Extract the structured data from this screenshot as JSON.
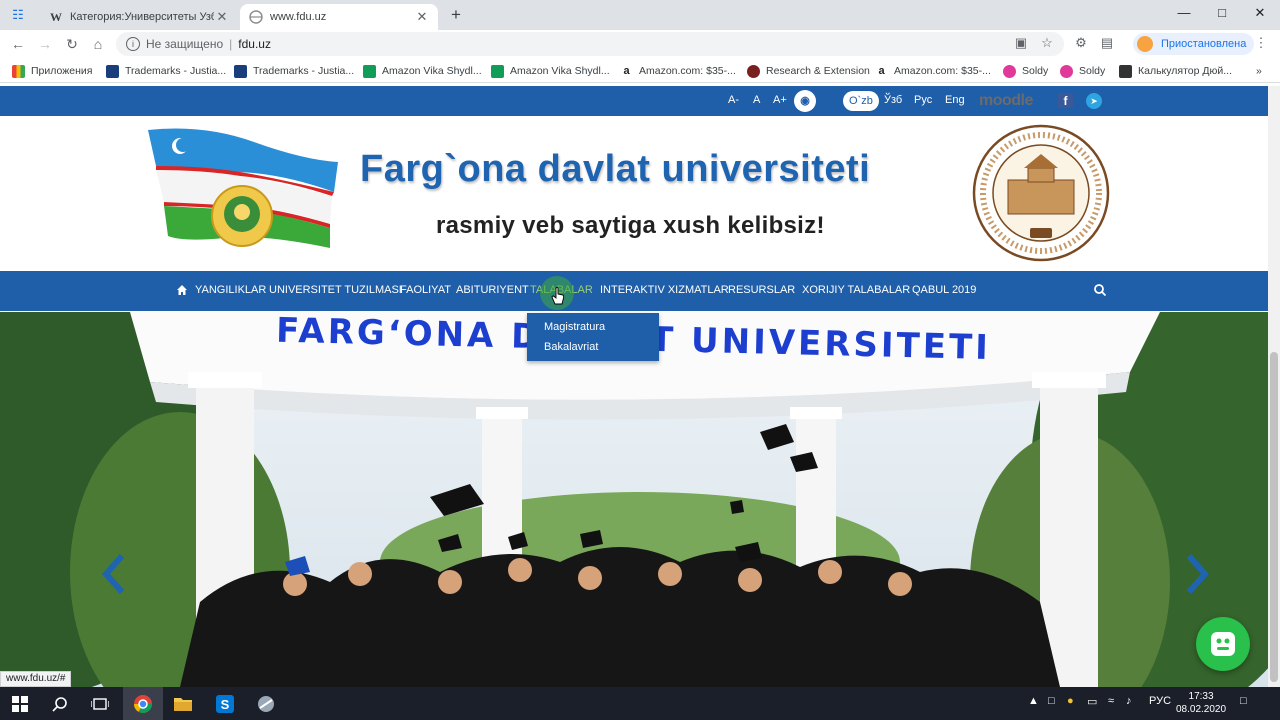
{
  "browser": {
    "tabs": [
      {
        "title": "Категория:Университеты Узбеки",
        "favicon": "W",
        "active": false
      },
      {
        "title": "www.fdu.uz",
        "favicon": "globe",
        "active": true
      }
    ],
    "address": {
      "security_label": "Не защищено",
      "url": "fdu.uz"
    },
    "profile_label": "Приостановлена",
    "bookmarks": [
      {
        "label": "Приложения",
        "icon": "apps-icon",
        "color": "#ea4335"
      },
      {
        "label": "Trademarks - Justia...",
        "icon": "justia-icon",
        "color": "#1a3d7c"
      },
      {
        "label": "Trademarks - Justia...",
        "icon": "justia-icon",
        "color": "#1a3d7c"
      },
      {
        "label": "Amazon Vika Shydl...",
        "icon": "sheets-icon",
        "color": "#0f9d58"
      },
      {
        "label": "Amazon Vika Shydl...",
        "icon": "sheets-icon",
        "color": "#0f9d58"
      },
      {
        "label": "Amazon.com: $35-...",
        "icon": "amazon-icon",
        "color": "#222222"
      },
      {
        "label": "Research & Extension",
        "icon": "research-icon",
        "color": "#7a1f1f"
      },
      {
        "label": "Amazon.com: $35-...",
        "icon": "amazon-icon",
        "color": "#222222"
      },
      {
        "label": "Soldy",
        "icon": "soldy-icon",
        "color": "#e0399a"
      },
      {
        "label": "Soldy",
        "icon": "soldy-icon",
        "color": "#e0399a"
      },
      {
        "label": "Калькулятор Дюй...",
        "icon": "calculator-icon",
        "color": "#333333"
      }
    ],
    "status_url": "www.fdu.uz/#"
  },
  "topbar": {
    "font_controls": [
      "A-",
      "A",
      "A+"
    ],
    "languages": [
      "O`zb",
      "Ўзб",
      "Рус",
      "Eng"
    ],
    "active_language": "O`zb",
    "moodle_label": "moodle"
  },
  "header": {
    "title": "Farg`ona davlat universiteti",
    "subtitle": "rasmiy veb saytiga xush kelibsiz!"
  },
  "nav": {
    "items": [
      "YANGILIKLAR",
      "UNIVERSITET TUZILMASI",
      "FAOLIYAT",
      "ABITURIYENT",
      "TALABALAR",
      "INTERAKTIV XIZMATLAR",
      "RESURSLAR",
      "XORIJIY TALABALAR",
      "QABUL 2019"
    ],
    "hovered": "TALABALAR",
    "dropdown": [
      "Magistratura",
      "Bakalavriat"
    ]
  },
  "hero": {
    "banner_text": "FARG‘ONA DAVLAT UNIVERSITETI"
  },
  "taskbar": {
    "language": "РУС",
    "time": "17:33",
    "date": "08.02.2020"
  },
  "colors": {
    "brand_blue": "#1f5ea8",
    "title_blue": "#1f64b0",
    "hover_green": "#9ad17a",
    "chat_green": "#29c04b"
  }
}
